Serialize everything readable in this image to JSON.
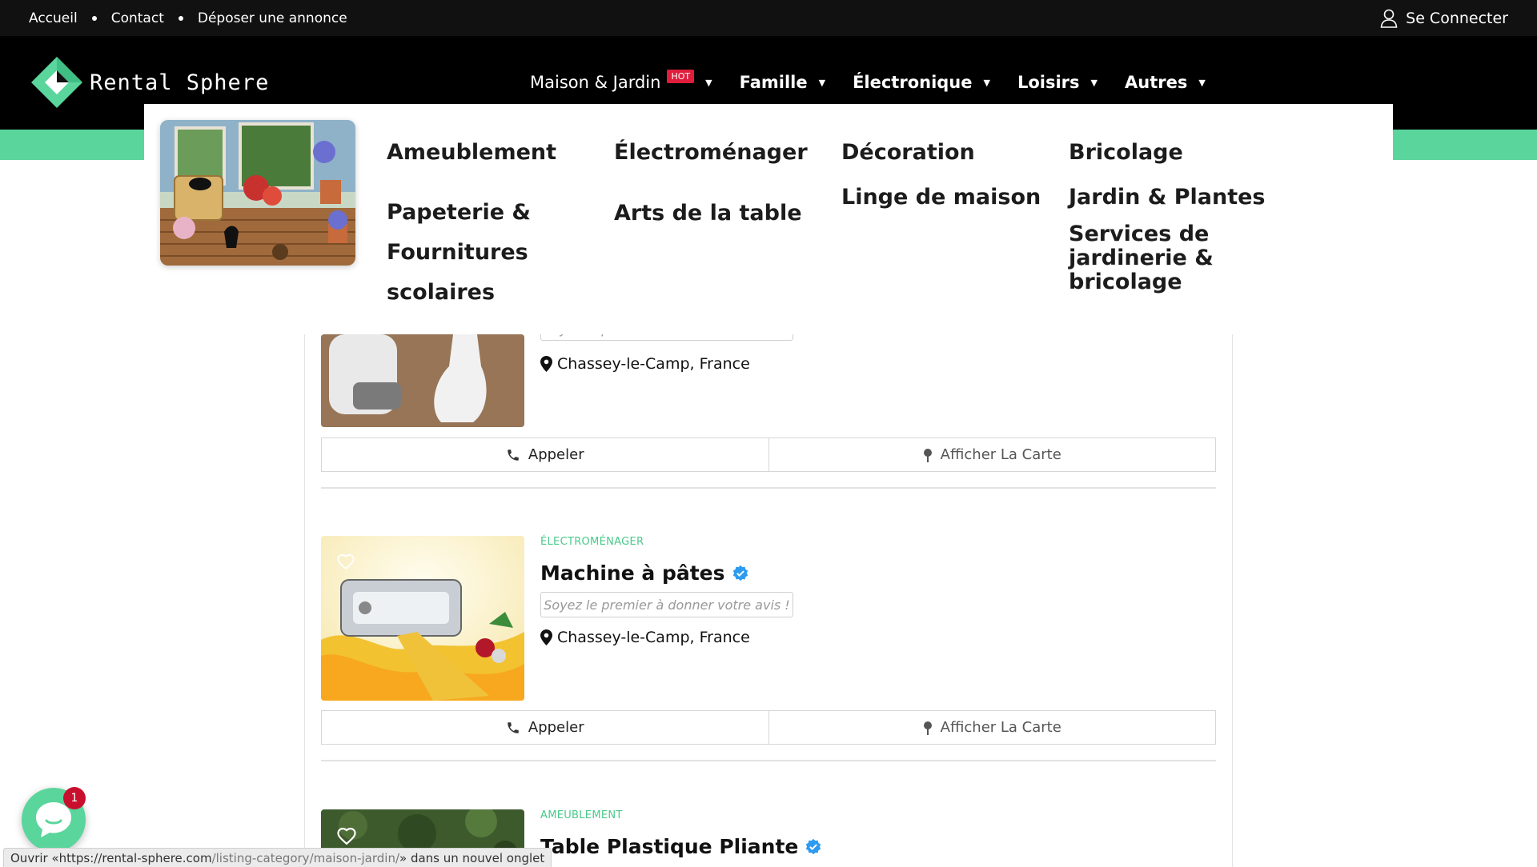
{
  "topbar": {
    "links": [
      "Accueil",
      "Contact",
      "Déposer une annonce"
    ],
    "login_label": "Se Connecter"
  },
  "brand": {
    "name": "Rental Sphere",
    "accent_color": "#5ad59b"
  },
  "nav": {
    "items": [
      {
        "label": "Maison & Jardin",
        "badge": "HOT"
      },
      {
        "label": "Famille"
      },
      {
        "label": "Électronique"
      },
      {
        "label": "Loisirs"
      },
      {
        "label": "Autres"
      }
    ]
  },
  "mega_menu": {
    "columns": [
      [
        "Ameublement",
        "Papeterie &",
        "Fournitures",
        "scolaires"
      ],
      [
        "Électroménager",
        "Arts de la table"
      ],
      [
        "Décoration",
        "Linge de maison"
      ],
      [
        "Bricolage",
        "Jardin & Plantes",
        "Services de",
        "jardinerie &",
        "bricolage"
      ]
    ]
  },
  "listings": [
    {
      "review_prompt": "Soyez le premier à donner votre avis !",
      "location": "Chassey-le-Camp, France",
      "call_label": "Appeler",
      "map_label": "Afficher La Carte"
    },
    {
      "category": "Électroménager",
      "title": "Machine à pâtes",
      "review_prompt": "Soyez le premier à donner votre avis !",
      "location": "Chassey-le-Camp, France",
      "call_label": "Appeler",
      "map_label": "Afficher La Carte"
    },
    {
      "category": "Ameublement",
      "title": "Table Plastique Pliante"
    }
  ],
  "chat": {
    "badge_count": "1"
  },
  "status_bar": {
    "prefix": "Ouvrir « ",
    "url_host": "https://rental-sphere.com",
    "url_path": "/listing-category/maison-jardin/",
    "suffix": " » dans un nouvel onglet"
  }
}
